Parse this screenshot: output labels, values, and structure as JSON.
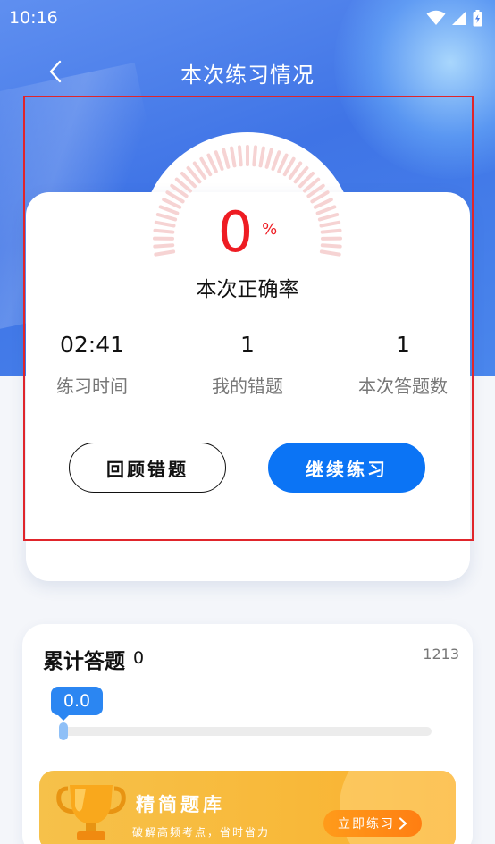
{
  "status_bar": {
    "time": "10:16"
  },
  "nav": {
    "title": "本次练习情况"
  },
  "result": {
    "accuracy_value": "0",
    "accuracy_unit": "%",
    "accuracy_label": "本次正确率",
    "stats": [
      {
        "value": "02:41",
        "label": "练习时间"
      },
      {
        "value": "1",
        "label": "我的错题"
      },
      {
        "value": "1",
        "label": "本次答题数"
      }
    ],
    "review_button": "回顾错题",
    "continue_button": "继续练习"
  },
  "cumulative": {
    "title": "累计答题",
    "count": "0",
    "max": "1213",
    "progress_label": "0.0",
    "progress_fraction": 0.0
  },
  "banner": {
    "title": "精简题库",
    "subtitle": "破解高频考点，省时省力",
    "button": "立即练习"
  },
  "colors": {
    "accent_blue": "#0b74f5",
    "accuracy_red": "#ee1c23",
    "gauge_tick": "#f6d3d3",
    "highlight_red": "#e0252b",
    "banner_orange": "#f8b93a"
  }
}
